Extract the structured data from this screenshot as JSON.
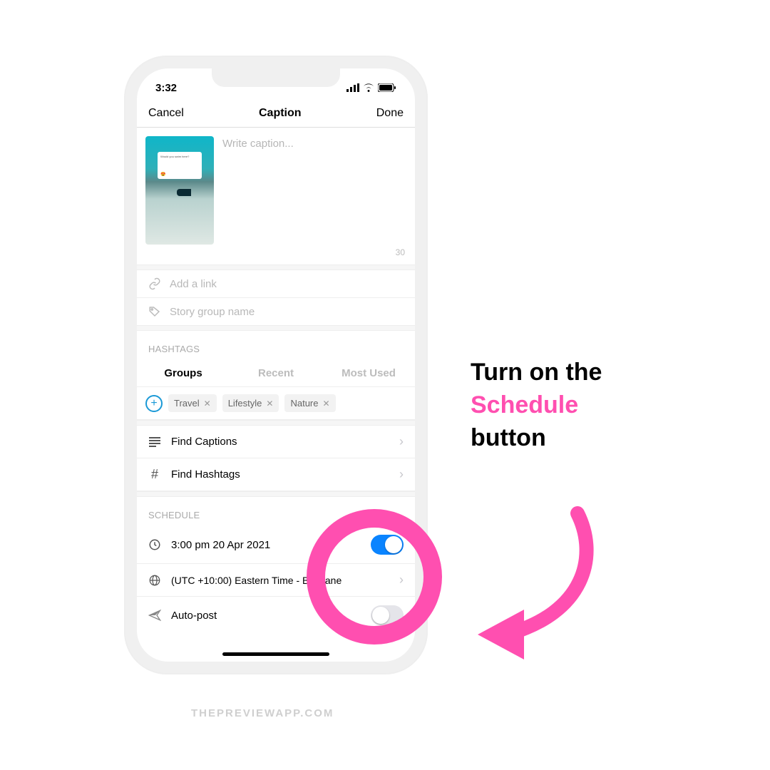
{
  "statusbar": {
    "time": "3:32"
  },
  "nav": {
    "cancel": "Cancel",
    "title": "Caption",
    "done": "Done"
  },
  "caption": {
    "placeholder": "Write caption...",
    "thumb_card_text": "Would you swim here?",
    "char_count": "30"
  },
  "links": {
    "add_link_placeholder": "Add a link",
    "story_group_placeholder": "Story group name"
  },
  "hashtags": {
    "section_label": "HASHTAGS",
    "tabs": {
      "groups": "Groups",
      "recent": "Recent",
      "most_used": "Most Used"
    },
    "chips": [
      "Travel",
      "Lifestyle",
      "Nature"
    ]
  },
  "actions": {
    "find_captions": "Find Captions",
    "find_hashtags": "Find Hashtags"
  },
  "schedule": {
    "section_label": "SCHEDULE",
    "datetime": "3:00 pm  20 Apr 2021",
    "timezone": "(UTC +10:00) Eastern Time - Brisbane",
    "autopost": "Auto-post"
  },
  "annotation": {
    "line1": "Turn on the",
    "line2": "Schedule",
    "line3": "button"
  },
  "footer": "THEPREVIEWAPP.COM"
}
